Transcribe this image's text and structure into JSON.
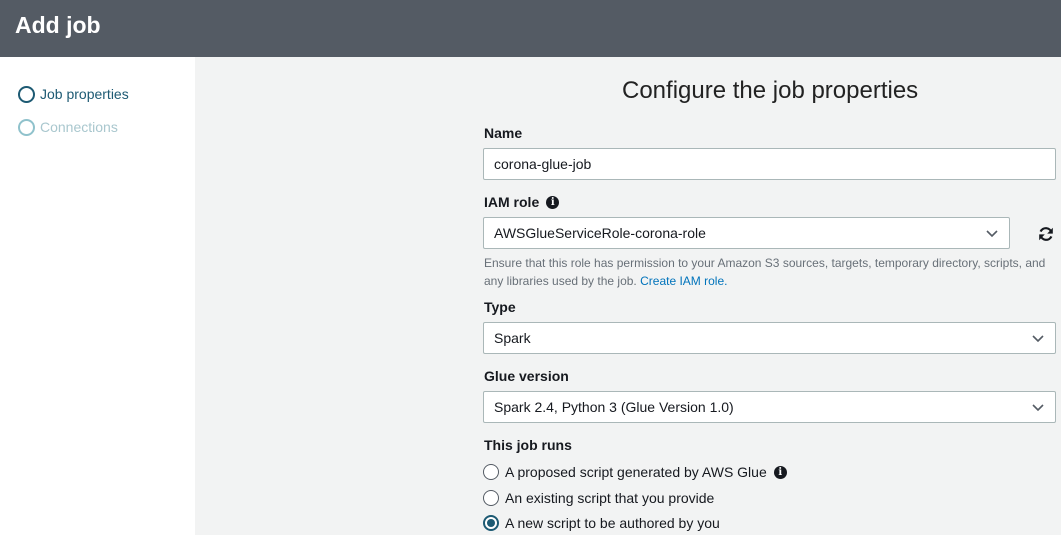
{
  "header": {
    "title": "Add job"
  },
  "sidebar": {
    "steps": [
      {
        "label": "Job properties",
        "state": "active"
      },
      {
        "label": "Connections",
        "state": "disabled"
      }
    ]
  },
  "form": {
    "heading": "Configure the job properties",
    "name": {
      "label": "Name",
      "value": "corona-glue-job"
    },
    "iam_role": {
      "label": "IAM role",
      "value": "AWSGlueServiceRole-corona-role",
      "hint_text": "Ensure that this role has permission to your Amazon S3 sources, targets, temporary directory, scripts, and any libraries used by the job.",
      "hint_link": "Create IAM role."
    },
    "type": {
      "label": "Type",
      "value": "Spark"
    },
    "glue_version": {
      "label": "Glue version",
      "value": "Spark 2.4, Python 3 (Glue Version 1.0)"
    },
    "job_runs": {
      "label": "This job runs",
      "options": [
        {
          "label": "A proposed script generated by AWS Glue",
          "checked": false
        },
        {
          "label": "An existing script that you provide",
          "checked": false
        },
        {
          "label": "A new script to be authored by you",
          "checked": true
        }
      ]
    }
  },
  "colors": {
    "header_bg": "#545b64",
    "accent": "#1d5a73",
    "link": "#0073bb"
  }
}
